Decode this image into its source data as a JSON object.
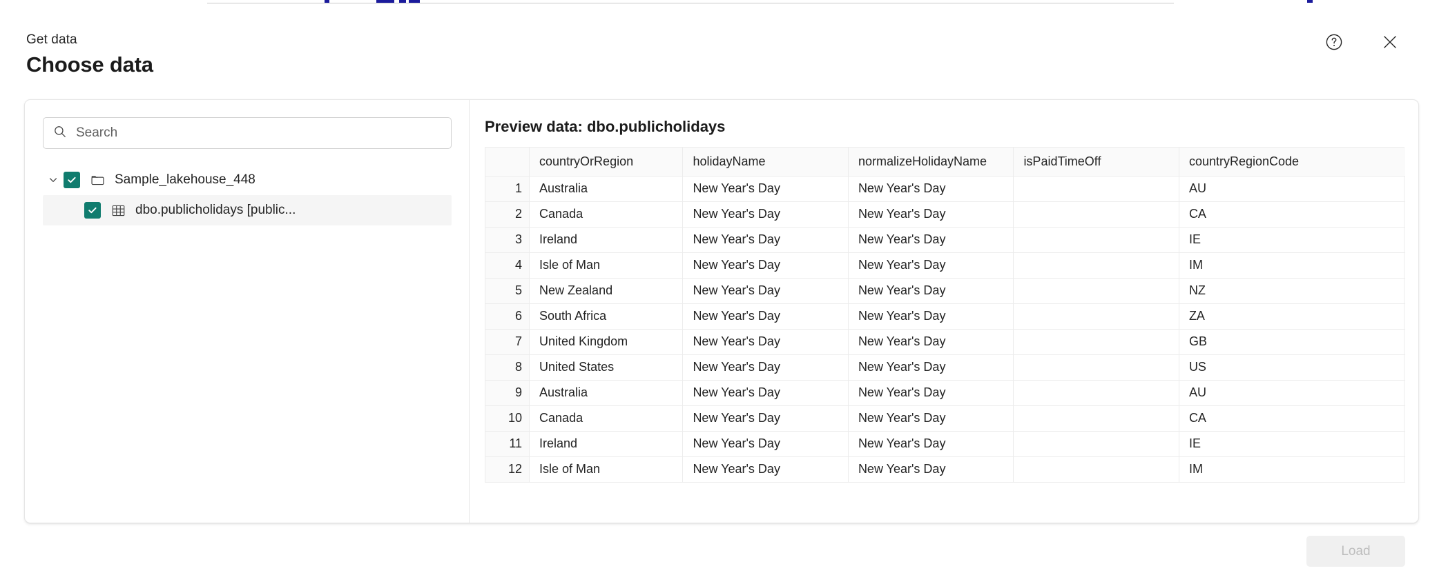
{
  "header": {
    "eyebrow": "Get data",
    "title": "Choose data",
    "help_icon": "help-circle-icon",
    "close_icon": "close-icon"
  },
  "left_pane": {
    "search": {
      "placeholder": "Search",
      "value": "",
      "icon": "search-icon"
    },
    "tree": [
      {
        "label": "Sample_lakehouse_448",
        "icon": "folder-icon",
        "checked": true,
        "expanded": true,
        "level": 0,
        "selected": false,
        "chevron": "chevron-down-icon"
      },
      {
        "label": "dbo.publicholidays [public...",
        "icon": "table-icon",
        "checked": true,
        "expanded": false,
        "level": 1,
        "selected": true,
        "chevron": ""
      }
    ]
  },
  "right_pane": {
    "preview_title": "Preview data: dbo.publicholidays",
    "table": {
      "index_header": "",
      "columns": [
        "countryOrRegion",
        "holidayName",
        "normalizeHolidayName",
        "isPaidTimeOff",
        "countryRegionCode"
      ],
      "rows": [
        {
          "index": "1",
          "cells": [
            "Australia",
            "New Year's Day",
            "New Year's Day",
            "",
            "AU"
          ]
        },
        {
          "index": "2",
          "cells": [
            "Canada",
            "New Year's Day",
            "New Year's Day",
            "",
            "CA"
          ]
        },
        {
          "index": "3",
          "cells": [
            "Ireland",
            "New Year's Day",
            "New Year's Day",
            "",
            "IE"
          ]
        },
        {
          "index": "4",
          "cells": [
            "Isle of Man",
            "New Year's Day",
            "New Year's Day",
            "",
            "IM"
          ]
        },
        {
          "index": "5",
          "cells": [
            "New Zealand",
            "New Year's Day",
            "New Year's Day",
            "",
            "NZ"
          ]
        },
        {
          "index": "6",
          "cells": [
            "South Africa",
            "New Year's Day",
            "New Year's Day",
            "",
            "ZA"
          ]
        },
        {
          "index": "7",
          "cells": [
            "United Kingdom",
            "New Year's Day",
            "New Year's Day",
            "",
            "GB"
          ]
        },
        {
          "index": "8",
          "cells": [
            "United States",
            "New Year's Day",
            "New Year's Day",
            "",
            "US"
          ]
        },
        {
          "index": "9",
          "cells": [
            "Australia",
            "New Year's Day",
            "New Year's Day",
            "",
            "AU"
          ]
        },
        {
          "index": "10",
          "cells": [
            "Canada",
            "New Year's Day",
            "New Year's Day",
            "",
            "CA"
          ]
        },
        {
          "index": "11",
          "cells": [
            "Ireland",
            "New Year's Day",
            "New Year's Day",
            "",
            "IE"
          ]
        },
        {
          "index": "12",
          "cells": [
            "Isle of Man",
            "New Year's Day",
            "New Year's Day",
            "",
            "IM"
          ]
        }
      ]
    }
  },
  "footer": {
    "load_label": "Load",
    "load_disabled": true
  },
  "colors": {
    "checkbox_green": "#107c6e",
    "text_primary": "#242424",
    "border": "#e6e6e6",
    "row_selected": "#f5f5f5",
    "table_header_bg": "#fafafa",
    "disabled_button_bg": "#f0f0f0",
    "disabled_button_text": "#bdbdbd"
  }
}
